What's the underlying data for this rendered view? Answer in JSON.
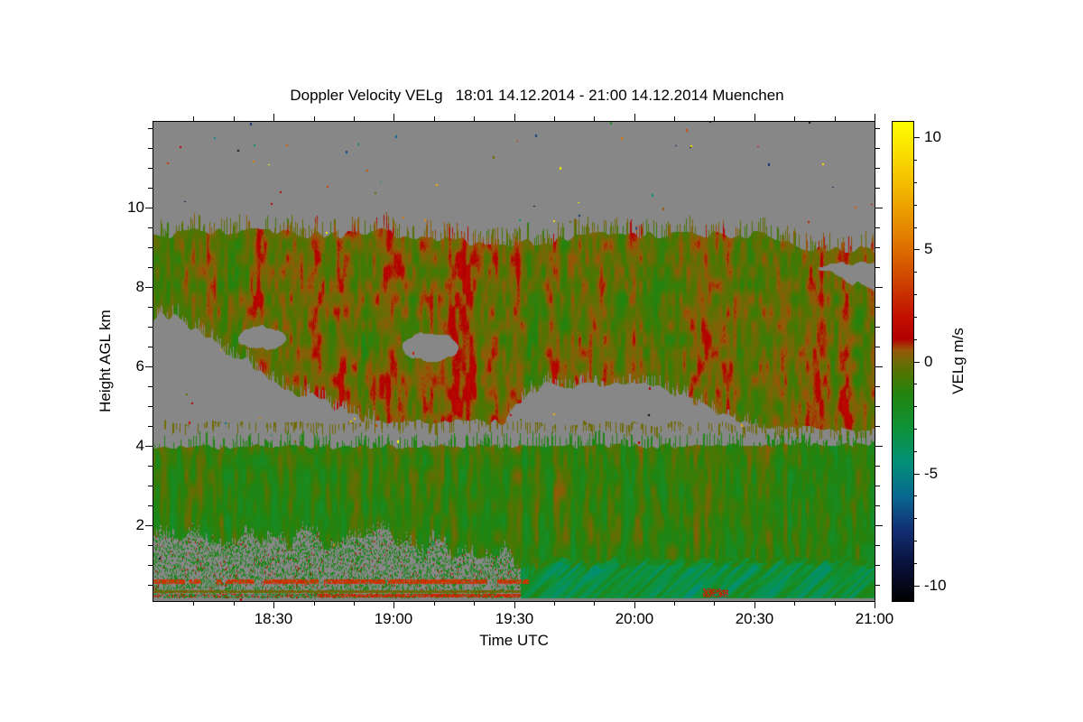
{
  "title": "Doppler Velocity VELg   18:01 14.12.2014 - 21:00 14.12.2014 Muenchen",
  "plot": {
    "x_axis": {
      "label": "Time UTC",
      "start": "18:01",
      "end": "21:00",
      "major_tick_labels": [
        "18:30",
        "19:00",
        "19:30",
        "20:00",
        "20:30",
        "21:00"
      ],
      "minor_tick_minutes": 10,
      "duration_minutes": 180
    },
    "y_axis": {
      "label": "Height AGL km",
      "min_km": 0.1,
      "max_km": 12.15,
      "major_ticks": [
        2,
        4,
        6,
        8,
        10
      ],
      "minor_step_km": 0.5
    },
    "no_data_color": "#878787",
    "background": "#ffffff"
  },
  "colorbar": {
    "label": "VELg m/s",
    "min": -10.7,
    "max": 10.7,
    "tick_values": [
      10,
      5,
      0,
      -5,
      -10
    ],
    "tick_labels": [
      "10",
      "5",
      "0",
      "-5",
      "-10"
    ],
    "minor_tick_step": 1,
    "stops": [
      [
        10.7,
        "#ffff00"
      ],
      [
        8,
        "#f4be00"
      ],
      [
        5.5,
        "#e27c00"
      ],
      [
        3.5,
        "#cc4000"
      ],
      [
        2,
        "#c31000"
      ],
      [
        1,
        "#b20000"
      ],
      [
        0.5,
        "#985808"
      ],
      [
        0,
        "#6e6a04"
      ],
      [
        -0.7,
        "#467804"
      ],
      [
        -1.5,
        "#218410"
      ],
      [
        -3,
        "#0e9238"
      ],
      [
        -4.5,
        "#029078"
      ],
      [
        -6,
        "#086890"
      ],
      [
        -7.5,
        "#122f74"
      ],
      [
        -9,
        "#0a123e"
      ],
      [
        -10.7,
        "#010101"
      ]
    ]
  },
  "chart_data": {
    "type": "heatmap",
    "measurement": "Doppler Velocity VELg",
    "site": "Muenchen",
    "time_start": "18:01 14.12.2014",
    "time_end": "21:00 14.12.2014",
    "x": {
      "label": "Time UTC",
      "range_minutes_after_1800": [
        0,
        180
      ]
    },
    "y": {
      "label": "Height AGL km",
      "range_km": [
        0.1,
        12.15
      ]
    },
    "value": {
      "label": "VELg m/s",
      "range": [
        -10.7,
        10.7
      ]
    },
    "regions": [
      {
        "name": "upper_cloud_layer",
        "kind": "texture",
        "t_range": [
          0,
          180
        ],
        "h_range": [
          3.95,
          9.4
        ],
        "vel_mean": 0.05,
        "vel_spread": 0.9,
        "top_profile_t": [
          0,
          20,
          40,
          55,
          75,
          85,
          95,
          110,
          125,
          140,
          152,
          160,
          166,
          173,
          180
        ],
        "top_profile_h": [
          9.32,
          9.4,
          9.3,
          9.38,
          9.18,
          9.05,
          9.12,
          9.3,
          9.28,
          9.32,
          9.3,
          9.1,
          8.9,
          8.95,
          8.93
        ]
      },
      {
        "name": "mid_level_gap",
        "kind": "no_data",
        "t_range": [
          0,
          180
        ],
        "top_profile_t": [
          0,
          140,
          160,
          180
        ],
        "top_profile_h": [
          4.62,
          4.58,
          4.45,
          4.4
        ],
        "bottom_profile_t": [
          0,
          140,
          180
        ],
        "bottom_profile_h": [
          3.97,
          4.0,
          4.06
        ]
      },
      {
        "name": "left_clear_region",
        "kind": "no_data",
        "t_range": [
          0,
          55
        ],
        "top_profile_t": [
          0,
          4.5,
          20,
          35,
          54
        ],
        "top_profile_h": [
          7.3,
          7.28,
          6.3,
          5.4,
          4.62
        ]
      },
      {
        "name": "clear_hole_1",
        "kind": "no_data_ellipse",
        "t_center": 27,
        "h_center": 6.72,
        "t_radius": 6,
        "h_radius": 0.28
      },
      {
        "name": "clear_hole_2",
        "kind": "no_data_ellipse",
        "t_center": 69,
        "h_center": 6.5,
        "t_radius": 7,
        "h_radius": 0.35
      },
      {
        "name": "central_clear_region",
        "kind": "no_data",
        "t_range": [
          88,
          156
        ],
        "top_profile_t": [
          88,
          90,
          98,
          126,
          140,
          156
        ],
        "top_profile_h": [
          4.6,
          5.0,
          5.55,
          5.5,
          4.9,
          4.15
        ]
      },
      {
        "name": "right_edge_notch",
        "kind": "no_data",
        "t_range": [
          166,
          180
        ],
        "top_profile_t": [
          166,
          180
        ],
        "top_profile_h": [
          8.55,
          8.62
        ],
        "bottom_profile_t": [
          166,
          180
        ],
        "bottom_profile_h": [
          8.45,
          7.9
        ]
      },
      {
        "name": "lower_cloud_layer",
        "kind": "texture",
        "t_range": [
          0,
          180
        ],
        "h_range": [
          1.0,
          3.95
        ],
        "vel_mean": -1.25,
        "vel_spread": 0.9
      },
      {
        "name": "boundary_layer_mixed",
        "kind": "sparse",
        "t_range": [
          0,
          91.5
        ],
        "top_profile_t": [
          0,
          10,
          30,
          50,
          70,
          80,
          91
        ],
        "top_profile_h": [
          1.55,
          1.75,
          1.6,
          1.7,
          1.5,
          1.3,
          1.12
        ],
        "fill_fraction": 0.32,
        "vel_mean": -1.5
      },
      {
        "name": "precip_band",
        "kind": "texture_slanted",
        "t_range": [
          91.5,
          180
        ],
        "top_profile_t": [
          91.5,
          100,
          180
        ],
        "top_profile_h": [
          1.05,
          1.12,
          1.15
        ],
        "h_bottom": 0.17,
        "vel_mean": -3.1,
        "vel_spread": 1.5
      },
      {
        "name": "ground_clutter_line_1",
        "kind": "line",
        "t_range": [
          0,
          93.5
        ],
        "h_range": [
          0.52,
          0.64
        ],
        "vel": 2.5,
        "solidity": 0.85
      },
      {
        "name": "ground_clutter_line_2",
        "kind": "line",
        "t_range": [
          0,
          91.5
        ],
        "h_range": [
          0.3,
          0.38
        ],
        "vel": -0.05,
        "solidity": 0.9
      },
      {
        "name": "ground_clutter_line_3",
        "kind": "line_mixed",
        "t_range": [
          0,
          91.5
        ],
        "h_range": [
          0.18,
          0.28
        ],
        "solid_from_t": 41,
        "vel": 2.3
      },
      {
        "name": "near_surface_red_patch",
        "kind": "patch",
        "t_range": [
          137,
          143.5
        ],
        "h_range": [
          0.2,
          0.42
        ],
        "vel": 2.0,
        "solidity": 0.55
      },
      {
        "name": "surface_gray_row",
        "kind": "no_data",
        "t_range": [
          0,
          180
        ],
        "h_range": [
          0.0,
          0.17
        ]
      },
      {
        "name": "noise_speckles",
        "kind": "speckle",
        "count": 230
      }
    ]
  }
}
